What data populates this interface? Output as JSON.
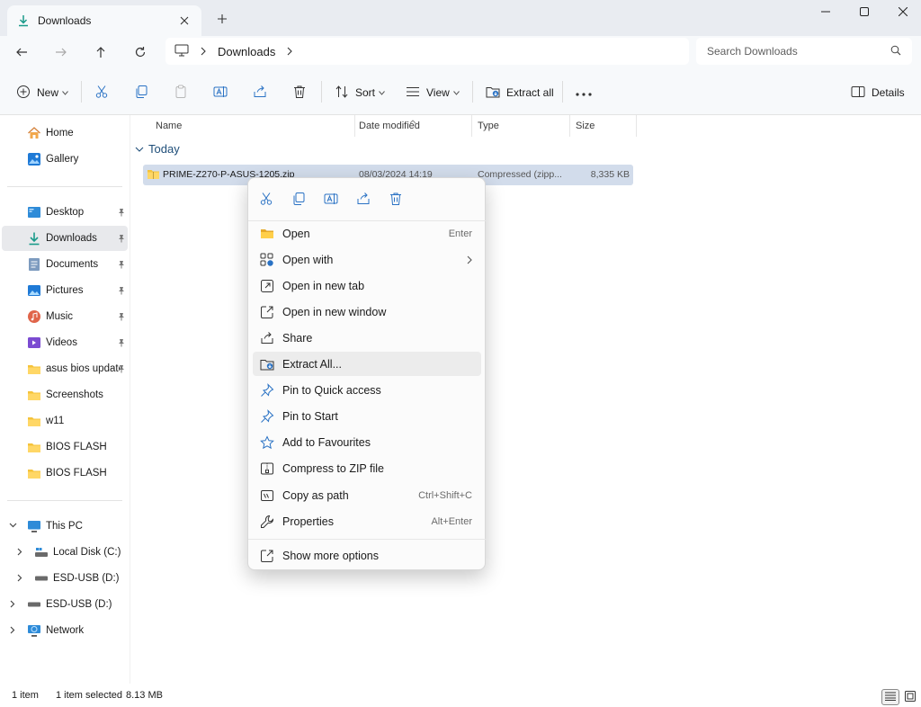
{
  "window": {
    "tab_title": "Downloads",
    "tab_icon": "download-icon",
    "new_tab_icon": "plus-icon",
    "controls": [
      "minimize-icon",
      "maximize-icon",
      "close-icon"
    ]
  },
  "address": {
    "location_icon": "monitor-icon",
    "crumbs": [
      "Downloads"
    ],
    "search_placeholder": "Search Downloads"
  },
  "toolbar": {
    "new_label": "New",
    "sort_label": "Sort",
    "view_label": "View",
    "extract_label": "Extract all",
    "details_label": "Details"
  },
  "sidebar": {
    "home": "Home",
    "gallery": "Gallery",
    "pinned": [
      {
        "label": "Desktop",
        "icon": "desktop-icon"
      },
      {
        "label": "Downloads",
        "icon": "download-icon",
        "selected": true
      },
      {
        "label": "Documents",
        "icon": "documents-icon"
      },
      {
        "label": "Pictures",
        "icon": "pictures-icon"
      },
      {
        "label": "Music",
        "icon": "music-icon"
      },
      {
        "label": "Videos",
        "icon": "videos-icon"
      },
      {
        "label": "asus bios update",
        "icon": "folder-icon"
      }
    ],
    "folders": [
      "Screenshots",
      "w11",
      "BIOS FLASH",
      "BIOS FLASH"
    ],
    "this_pc": "This PC",
    "drives": [
      "Local Disk (C:)",
      "ESD-USB (D:)"
    ],
    "esd_root": "ESD-USB (D:)",
    "network": "Network"
  },
  "columns": {
    "name": "Name",
    "date": "Date modified",
    "type": "Type",
    "size": "Size"
  },
  "group_label": "Today",
  "file": {
    "name": "PRIME-Z270-P-ASUS-1205.zip",
    "date": "08/03/2024 14:19",
    "type": "Compressed (zipp...",
    "size": "8,335 KB"
  },
  "context_menu": {
    "quick_actions": [
      "cut-icon",
      "copy-icon",
      "rename-icon",
      "share-icon",
      "delete-icon"
    ],
    "items": [
      {
        "label": "Open",
        "shortcut": "Enter",
        "icon": "folder-open-icon"
      },
      {
        "label": "Open with",
        "shortcut": "",
        "icon": "open-with-icon",
        "submenu": true
      },
      {
        "label": "Open in new tab",
        "shortcut": "",
        "icon": "new-tab-icon"
      },
      {
        "label": "Open in new window",
        "shortcut": "",
        "icon": "new-window-icon"
      },
      {
        "label": "Share",
        "shortcut": "",
        "icon": "share-icon"
      },
      {
        "label": "Extract All...",
        "shortcut": "",
        "icon": "extract-icon",
        "highlighted": true
      },
      {
        "label": "Pin to Quick access",
        "shortcut": "",
        "icon": "pin-icon"
      },
      {
        "label": "Pin to Start",
        "shortcut": "",
        "icon": "pin-icon"
      },
      {
        "label": "Add to Favourites",
        "shortcut": "",
        "icon": "star-icon"
      },
      {
        "label": "Compress to ZIP file",
        "shortcut": "",
        "icon": "zip-icon"
      },
      {
        "label": "Copy as path",
        "shortcut": "Ctrl+Shift+C",
        "icon": "copy-path-icon"
      },
      {
        "label": "Properties",
        "shortcut": "Alt+Enter",
        "icon": "properties-icon"
      }
    ],
    "more": {
      "label": "Show more options",
      "icon": "more-options-icon"
    }
  },
  "status": {
    "count": "1 item",
    "selected": "1 item selected",
    "size": "8.13 MB"
  },
  "colors": {
    "accent": "#0067c0",
    "selection": "#d2dceb",
    "folder": "#f5c33b"
  }
}
